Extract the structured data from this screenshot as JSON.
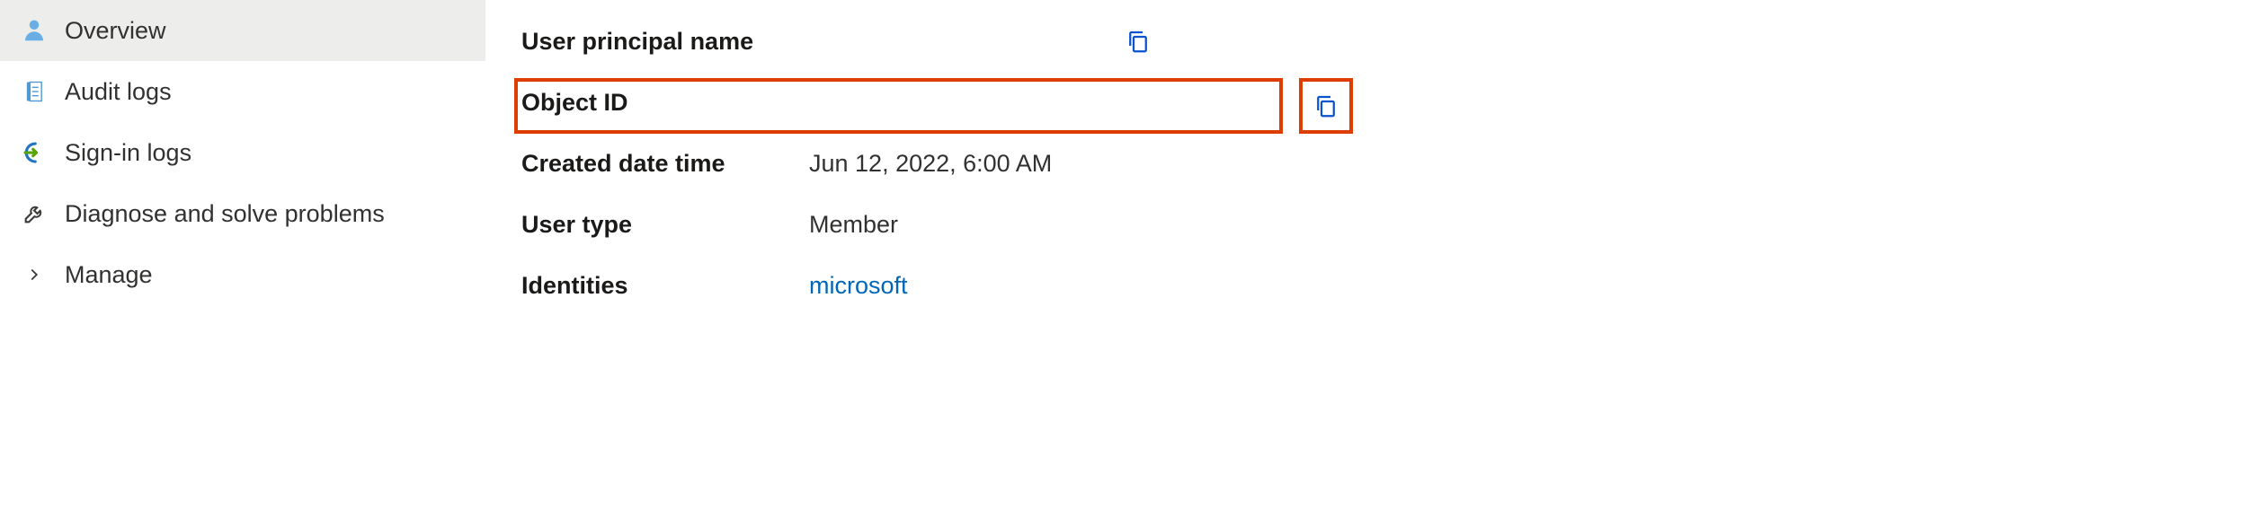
{
  "sidebar": {
    "items": [
      {
        "label": "Overview",
        "icon": "person-icon"
      },
      {
        "label": "Audit logs",
        "icon": "log-icon"
      },
      {
        "label": "Sign-in logs",
        "icon": "signin-icon"
      },
      {
        "label": "Diagnose and solve problems",
        "icon": "wrench-icon"
      },
      {
        "label": "Manage",
        "icon": "chevron-right-icon"
      }
    ]
  },
  "main": {
    "rows": [
      {
        "label": "User principal name",
        "value": "",
        "copyable": true,
        "link": false
      },
      {
        "label": "Object ID",
        "value": "",
        "copyable": true,
        "link": false,
        "highlighted": true
      },
      {
        "label": "Created date time",
        "value": "Jun 12, 2022, 6:00 AM",
        "copyable": false,
        "link": false
      },
      {
        "label": "User type",
        "value": "Member",
        "copyable": false,
        "link": false
      },
      {
        "label": "Identities",
        "value": "microsoft",
        "copyable": false,
        "link": true
      }
    ]
  },
  "colors": {
    "highlight": "#de3d00",
    "link": "#0067b8",
    "copyIcon": "#0b53ce"
  }
}
